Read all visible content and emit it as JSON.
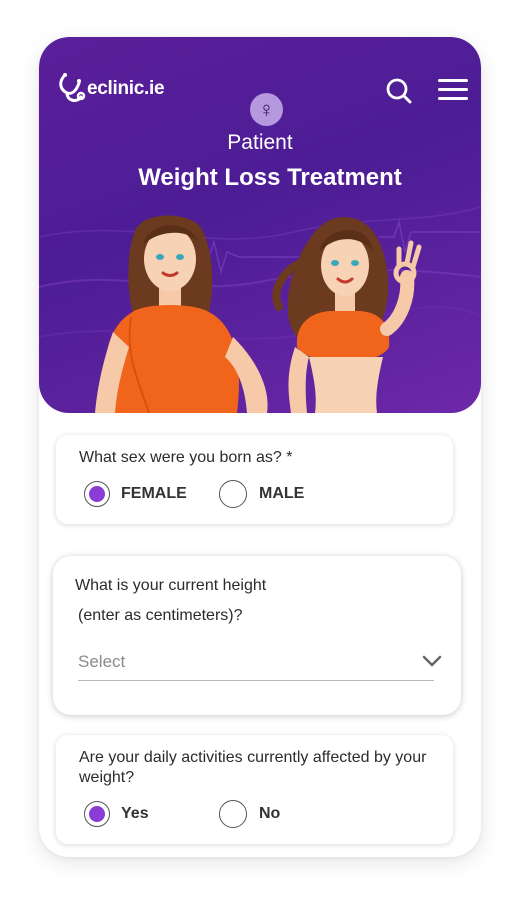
{
  "header": {
    "logo_text": "eclinic.ie",
    "subtitle": "Patient",
    "title": "Weight Loss Treatment",
    "gender_symbol": "♀",
    "icons": {
      "search": "search-icon",
      "menu": "hamburger-menu-icon",
      "gender": "female-symbol-icon"
    }
  },
  "colors": {
    "brand_purple": "#4c1d95",
    "radio_selected": "#8b3bd6",
    "badge_bg": "#b598dd",
    "shirt_orange": "#f0641c"
  },
  "questions": {
    "sex": {
      "label": "What sex were you born as? *",
      "options": [
        {
          "label": "FEMALE",
          "selected": true
        },
        {
          "label": "MALE",
          "selected": false
        }
      ]
    },
    "height": {
      "label_line1": "What is your current height",
      "label_line2": "(enter as centimeters)?",
      "placeholder": "Select"
    },
    "activities": {
      "label": "Are your daily activities currently affected by your weight?",
      "options": [
        {
          "label": "Yes",
          "selected": true
        },
        {
          "label": "No",
          "selected": false
        }
      ]
    }
  }
}
